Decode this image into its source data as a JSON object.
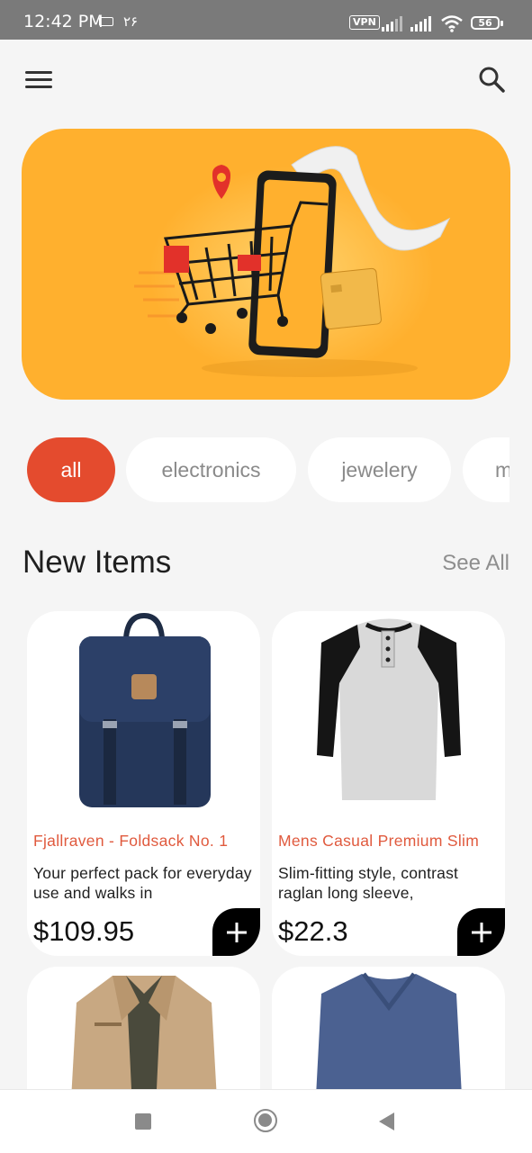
{
  "status_bar": {
    "time": "12:42 PM",
    "date": "۲۶",
    "vpn": "VPN",
    "battery": "56"
  },
  "header": {
    "menu_icon": "menu-icon",
    "search_icon": "search-icon"
  },
  "categories": [
    {
      "label": "all",
      "active": true
    },
    {
      "label": "electronics",
      "active": false
    },
    {
      "label": "jewelery",
      "active": false
    },
    {
      "label": "m",
      "active": false
    }
  ],
  "section": {
    "title": "New Items",
    "see_all": "See All"
  },
  "products": [
    {
      "title": "Fjallraven - Foldsack No. 1",
      "description": "Your perfect pack for everyday use and walks in",
      "price": "$109.95",
      "image": "backpack"
    },
    {
      "title": "Mens Casual Premium Slim",
      "description": "Slim-fitting style, contrast raglan long sleeve,",
      "price": "$22.3",
      "image": "raglan-tshirt"
    },
    {
      "title": "",
      "description": "",
      "price": "",
      "image": "cotton-jacket"
    },
    {
      "title": "",
      "description": "",
      "price": "",
      "image": "slim-fit-tshirt"
    }
  ],
  "colors": {
    "accent": "#e44b2e",
    "banner": "#ffb02e",
    "price_title": "#e05a3e"
  }
}
